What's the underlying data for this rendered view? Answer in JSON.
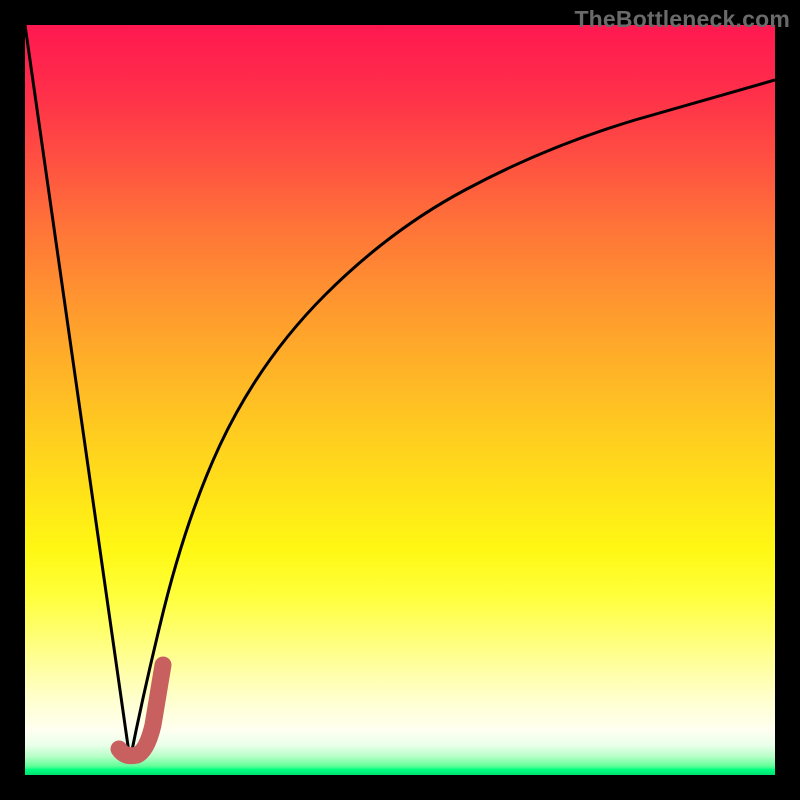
{
  "watermark": "TheBottleneck.com",
  "colors": {
    "frame": "#000000",
    "curve_stroke": "#000000",
    "marker_stroke": "#c86060"
  },
  "chart_data": {
    "type": "line",
    "title": "",
    "xlabel": "",
    "ylabel": "",
    "xlim": [
      0,
      100
    ],
    "ylim": [
      0,
      100
    ],
    "grid": false,
    "series": [
      {
        "name": "left-line",
        "x": [
          0,
          14
        ],
        "values": [
          100,
          2
        ]
      },
      {
        "name": "right-curve",
        "x": [
          14,
          16,
          18,
          20,
          24,
          28,
          34,
          40,
          48,
          56,
          64,
          72,
          80,
          88,
          96,
          100
        ],
        "values": [
          2,
          10,
          20,
          30,
          44,
          54,
          64,
          72,
          78,
          82,
          85.5,
          88,
          89.8,
          91.3,
          92.5,
          93
        ]
      }
    ],
    "marker": {
      "name": "j-marker",
      "x": [
        12.5,
        14.5,
        16.5,
        18.0
      ],
      "values": [
        3.5,
        2.5,
        7.0,
        15.0
      ]
    }
  }
}
